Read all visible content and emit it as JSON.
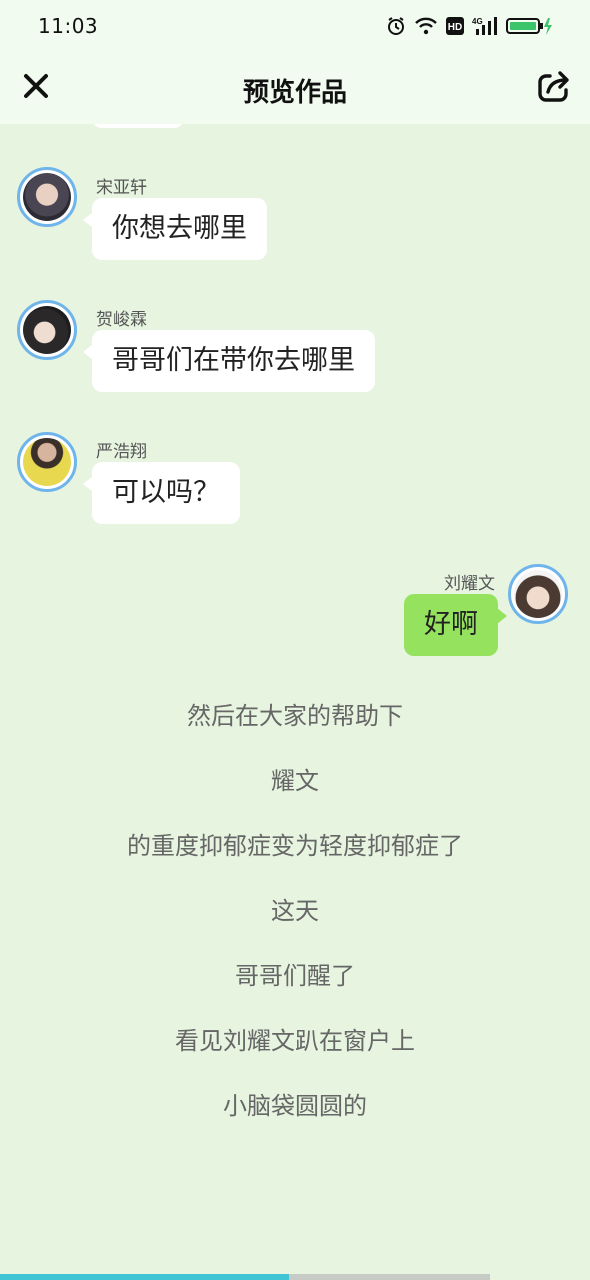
{
  "status": {
    "time": "11:03"
  },
  "header": {
    "title": "预览作品"
  },
  "messages": [
    {
      "name": "宋亚轩",
      "text": "你想去哪里"
    },
    {
      "name": "贺峻霖",
      "text": "哥哥们在带你去哪里"
    },
    {
      "name": "严浩翔",
      "text": "可以吗？"
    },
    {
      "name": "刘耀文",
      "text": "好啊"
    }
  ],
  "narration": [
    "然后在大家的帮助下",
    "耀文",
    "的重度抑郁症变为轻度抑郁症了",
    "这天",
    "哥哥们醒了",
    "看见刘耀文趴在窗户上",
    "小脑袋圆圆的"
  ],
  "colors": {
    "background": "#e6f4e0",
    "bubble_self": "#95e25f",
    "avatar_ring": "#6fb4ea",
    "progress": "#3fc4d6"
  },
  "progress": {
    "fraction": 0.49
  }
}
